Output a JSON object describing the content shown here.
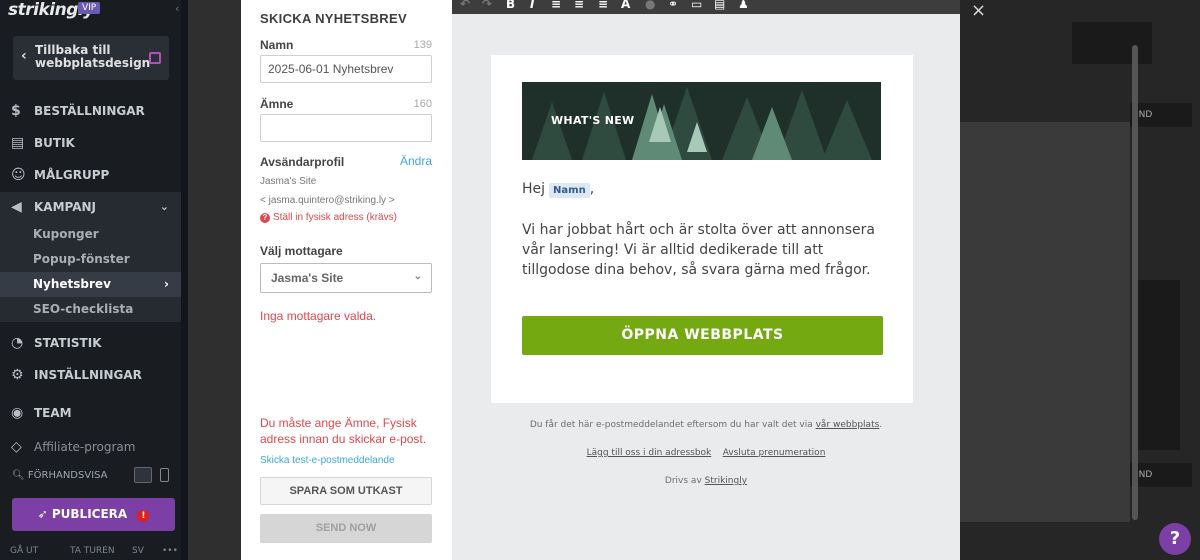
{
  "brand": {
    "logo": "strikingly",
    "badge": "VIP"
  },
  "sidebar": {
    "back_label": "Tillbaka till webbplatsdesign",
    "items": [
      {
        "label": "BESTÄLLNINGAR",
        "icon": "dollar-circle-icon"
      },
      {
        "label": "BUTIK",
        "icon": "store-icon"
      },
      {
        "label": "MÅLGRUPP",
        "icon": "audience-icon"
      },
      {
        "label": "KAMPANJ",
        "icon": "megaphone-icon"
      },
      {
        "label": "STATISTIK",
        "icon": "chart-pie-icon"
      },
      {
        "label": "INSTÄLLNINGAR",
        "icon": "gear-icon"
      },
      {
        "label": "TEAM",
        "icon": "team-icon"
      },
      {
        "label": "Affiliate-program",
        "icon": "affiliate-icon"
      }
    ],
    "sub_items": [
      "Kuponger",
      "Popup-fönster",
      "Nyhetsbrev",
      "SEO-checklista"
    ],
    "preview_label": "FÖRHANDSVISA",
    "publish_label": "PUBLICERA",
    "publish_warn": "!",
    "bottom_links": [
      "GÅ UT",
      "TA TUREN",
      "SV",
      "•••"
    ]
  },
  "form": {
    "title": "SKICKA NYHETSBREV",
    "name_label": "Namn",
    "name_count": "139",
    "name_value": "2025-06-01 Nyhetsbrev",
    "subject_label": "Ämne",
    "subject_count": "160",
    "subject_value": "",
    "sender_label": "Avsändarprofil",
    "sender_change": "Ändra",
    "sender_name": "Jasma's Site",
    "sender_email": "< jasma.quintero@striking.ly >",
    "address_error": "Ställ in fysisk adress (krävs)",
    "recipients_label": "Välj mottagare",
    "recipients_value": "Jasma's Site",
    "no_recipients": "Inga mottagare valda.",
    "must_error": "Du måste ange Ämne, Fysisk adress innan du skickar e-post.",
    "test_link": "Skicka test-e-postmeddelande",
    "save_draft": "SPARA SOM UTKAST",
    "send_now": "SEND NOW"
  },
  "toolbar": {
    "icons": [
      "undo-icon",
      "redo-icon",
      "bold-icon",
      "italic-icon",
      "align-left-icon",
      "align-center-icon",
      "align-right-icon",
      "font-color-icon",
      "highlight-icon",
      "link-icon",
      "button-icon",
      "image-icon",
      "person-icon"
    ]
  },
  "email": {
    "banner_text": "WHAT'S NEW",
    "greeting": "Hej",
    "name_tag": "Namn",
    "greeting_end": ",",
    "body": "Vi har jobbat hårt och är stolta över att annonsera vår lansering! Vi är alltid dedikerade till att tillgodose dina behov, så svara gärna med frågor.",
    "cta": "ÖPPNA WEBBPLATS",
    "footer_note": "Du får det här e-postmeddelandet eftersom du har valt det via",
    "footer_link": "vår webbplats",
    "footer_period": ".",
    "addressbook_link": "Lägg till oss i din adressbok",
    "unsubscribe_link": "Avsluta prenumeration",
    "powered_prefix": "Drivs av",
    "powered_link": "Strikingly"
  },
  "background_editor": {
    "partial_label": "UND"
  },
  "help": "?",
  "close": "×"
}
